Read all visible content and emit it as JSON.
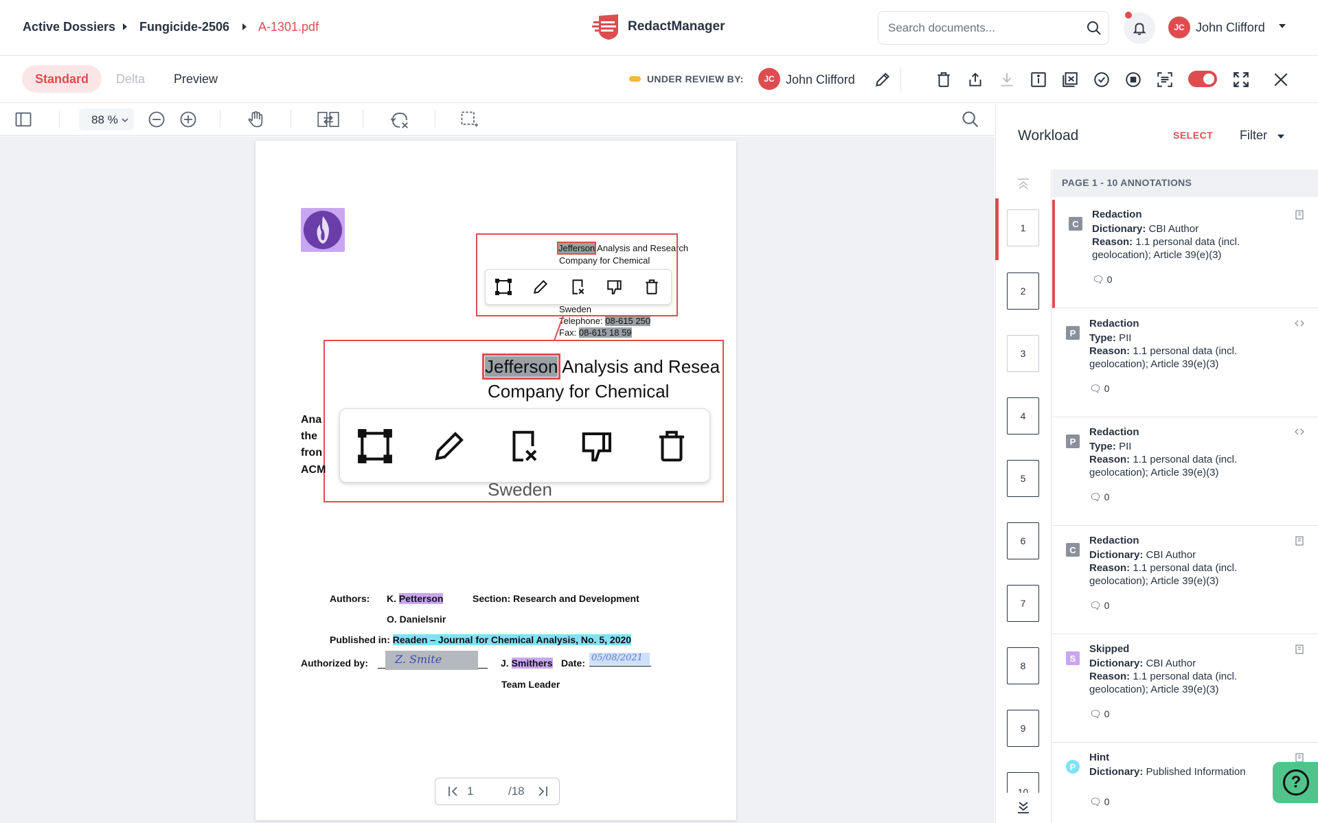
{
  "header": {
    "breadcrumbs": [
      "Active Dossiers",
      "Fungicide-2506",
      "A-1301.pdf"
    ],
    "brand": "RedactManager",
    "search_placeholder": "Search documents...",
    "user_initials": "JC",
    "user_name": "John Clifford"
  },
  "subbar": {
    "tabs": [
      "Standard",
      "Delta",
      "Preview"
    ],
    "status_label": "UNDER REVIEW BY:",
    "reviewer_initials": "JC",
    "reviewer_name": "John Clifford",
    "accent_color": "#dd4d50",
    "status_color": "#f6b83d"
  },
  "viewer": {
    "zoom": "88 %",
    "page_current": "1",
    "page_total": "/18"
  },
  "document": {
    "company_word": "Jefferson",
    "company_rest": " Analysis and Research",
    "company_line2": "Company for Chemical",
    "country": "Sweden",
    "telephone_label": "Telephone: ",
    "telephone_value": "08-615 250",
    "fax_label": "Fax: ",
    "fax_value": "08-615 18 59",
    "zoom_word": "Jefferson",
    "zoom_rest": " Analysis and Resea",
    "zoom_line2": "Company for Chemical",
    "zoom_country": "Sweden",
    "left_lines": [
      "Ana",
      "the",
      "fron",
      "ACM"
    ],
    "authors_label": "Authors:",
    "author1_prefix": "K. ",
    "author1_name": "Petterson",
    "author2": "O. Danielsnir",
    "section": "Section: Research and Development",
    "published_label": "Published in: ",
    "published_value": "Readen – Journal for Chemical Analysis, No. 5, 2020",
    "authorized_label": "Authorized by:",
    "signer_prefix": "J. ",
    "signer_name": "Smithers",
    "date_label": "Date:",
    "date_value": "05/08/2021",
    "team_leader": "Team Leader",
    "signature_text": "Z. Smite"
  },
  "workload": {
    "title": "Workload",
    "select": "SELECT",
    "filter": "Filter",
    "page_header": "PAGE 1 - 10 ANNOTATIONS",
    "thumbs": [
      "1",
      "2",
      "3",
      "4",
      "5",
      "6",
      "7",
      "8",
      "9",
      "10"
    ],
    "annotations": [
      {
        "badge": "C",
        "badge_color": "#8a919c",
        "title": "Redaction",
        "line1_key": "Dictionary:",
        "line1_val": " CBI Author",
        "reason_key": "Reason:",
        "reason_val": " 1.1 personal data (incl.",
        "reason_cont": "geolocation); Article 39(e)(3)",
        "comments": "0"
      },
      {
        "badge": "P",
        "badge_color": "#8a919c",
        "title": "Redaction",
        "line1_key": "Type:",
        "line1_val": " PII",
        "reason_key": "Reason:",
        "reason_val": " 1.1 personal data (incl.",
        "reason_cont": "geolocation); Article 39(e)(3)",
        "comments": "0"
      },
      {
        "badge": "P",
        "badge_color": "#8a919c",
        "title": "Redaction",
        "line1_key": "Type:",
        "line1_val": " PII",
        "reason_key": "Reason:",
        "reason_val": " 1.1 personal data (incl.",
        "reason_cont": "geolocation); Article 39(e)(3)",
        "comments": "0"
      },
      {
        "badge": "C",
        "badge_color": "#8a919c",
        "title": "Redaction",
        "line1_key": "Dictionary:",
        "line1_val": " CBI Author",
        "reason_key": "Reason:",
        "reason_val": " 1.1 personal data (incl.",
        "reason_cont": "geolocation); Article 39(e)(3)",
        "comments": "0"
      },
      {
        "badge": "S",
        "badge_color": "#c9a6f0",
        "title": "Skipped",
        "line1_key": "Dictionary:",
        "line1_val": " CBI Author",
        "reason_key": "Reason:",
        "reason_val": " 1.1 personal data (incl.",
        "reason_cont": "geolocation); Article 39(e)(3)",
        "comments": "0"
      },
      {
        "badge": "P",
        "badge_color": "#7fe3f5",
        "title": "Hint",
        "line1_key": "Dictionary:",
        "line1_val": " Published Information",
        "reason_key": "",
        "reason_val": "",
        "reason_cont": "",
        "comments": "0"
      }
    ]
  },
  "help": "?"
}
